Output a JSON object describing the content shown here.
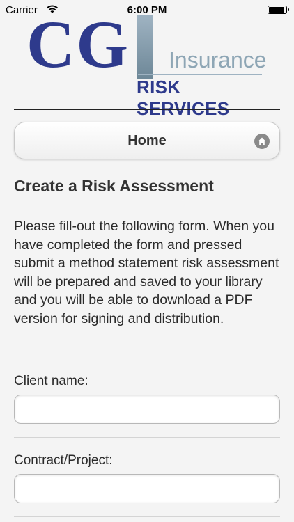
{
  "status_bar": {
    "carrier": "Carrier",
    "time": "6:00 PM"
  },
  "logo": {
    "brand": "CG",
    "letter_i": "I",
    "insurance": "Insurance",
    "risk_services": "RISK SERVICES"
  },
  "nav": {
    "home_label": "Home"
  },
  "form": {
    "title": "Create a Risk Assessment",
    "intro": "Please fill-out the following form. When you have completed the form and pressed submit a method statement risk assessment will be prepared and saved to your library and you will be able to download a PDF version for signing and distribution.",
    "fields": [
      {
        "label": "Client name:",
        "value": ""
      },
      {
        "label": "Contract/Project:",
        "value": ""
      }
    ]
  },
  "colors": {
    "brand_blue": "#2e3a8c",
    "brand_steel": "#8ea6b5"
  },
  "icons": {
    "home": "home-icon",
    "wifi": "wifi-icon",
    "battery": "battery-icon"
  }
}
